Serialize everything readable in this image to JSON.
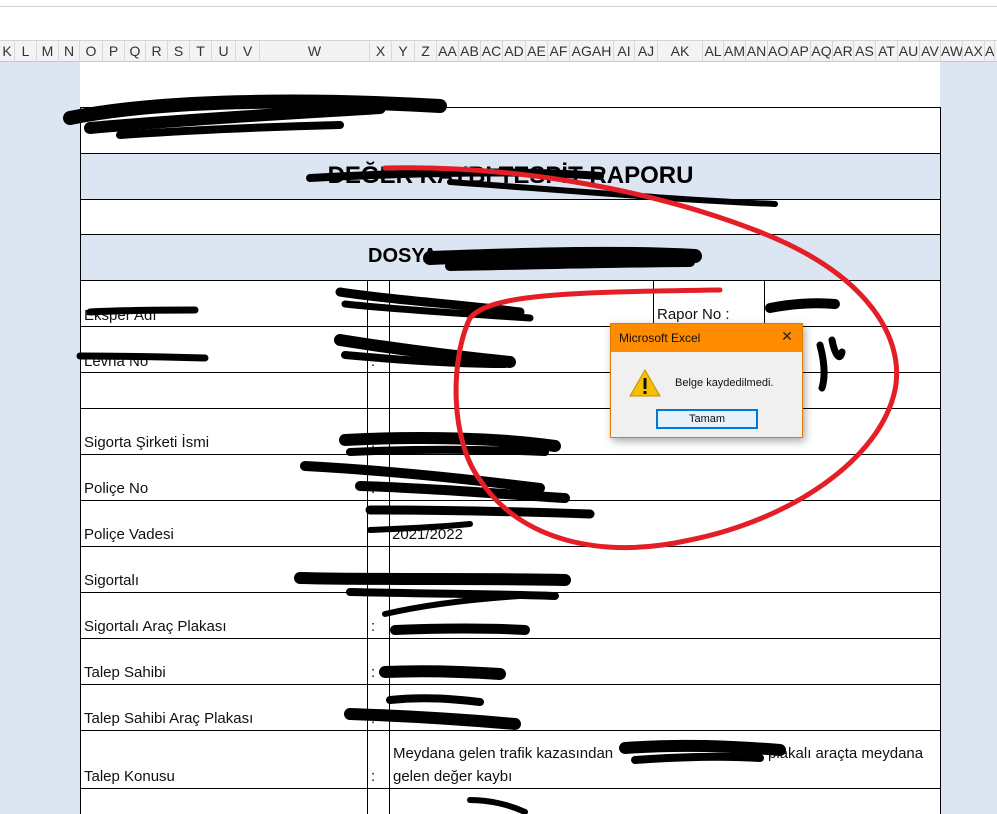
{
  "column_headers": [
    "K",
    "L",
    "M",
    "N",
    "O",
    "P",
    "Q",
    "R",
    "S",
    "T",
    "U",
    "V",
    "W",
    "X",
    "Y",
    "Z",
    "AA",
    "AB",
    "AC",
    "AD",
    "AE",
    "AF",
    "AGAH",
    "AI",
    "AJ",
    "AK",
    "AL",
    "AM",
    "AN",
    "AO",
    "AP",
    "AQ",
    "AR",
    "AS",
    "AT",
    "AU",
    "AV",
    "AW",
    "AX",
    "A"
  ],
  "report": {
    "title": "DEĞER KAYBI TESPİT RAPORU",
    "file_label": "DOSYA",
    "rows": [
      {
        "label": "Eksper Adı",
        "colon": ""
      },
      {
        "label": "Levha No",
        "colon": ":"
      },
      {
        "label": "Sigorta Şirketi İsmi",
        "colon": ":"
      },
      {
        "label": "Poliçe No",
        "colon": ":"
      },
      {
        "label": "Poliçe Vadesi",
        "colon": ":"
      },
      {
        "label": "Sigortalı",
        "colon": ""
      },
      {
        "label": "Sigortalı Araç Plakası",
        "colon": ":"
      },
      {
        "label": "Talep Sahibi",
        "colon": ":"
      },
      {
        "label": "Talep Sahibi Araç Plakası",
        "colon": ":"
      },
      {
        "label": "Talep Konusu",
        "colon": ":"
      }
    ],
    "report_no_label": "Rapor No :",
    "talep_konusu_line1": "Meydana gelen trafik kazasından",
    "talep_konusu_line1b": "plakalı araçta meydana",
    "talep_konusu_line2": "gelen değer kaybı",
    "policy_vadesi_value": "2021/2022"
  },
  "dialog": {
    "title": "Microsoft Excel",
    "close_glyph": "✕",
    "message": "Belge kaydedilmedi.",
    "ok_button": "Tamam",
    "icon": "warning-icon"
  },
  "colors": {
    "dialog_title_bg": "#ff8c00",
    "header_band": "#dce6f2",
    "annotation_red": "#e41e26",
    "button_border": "#0078d7"
  }
}
